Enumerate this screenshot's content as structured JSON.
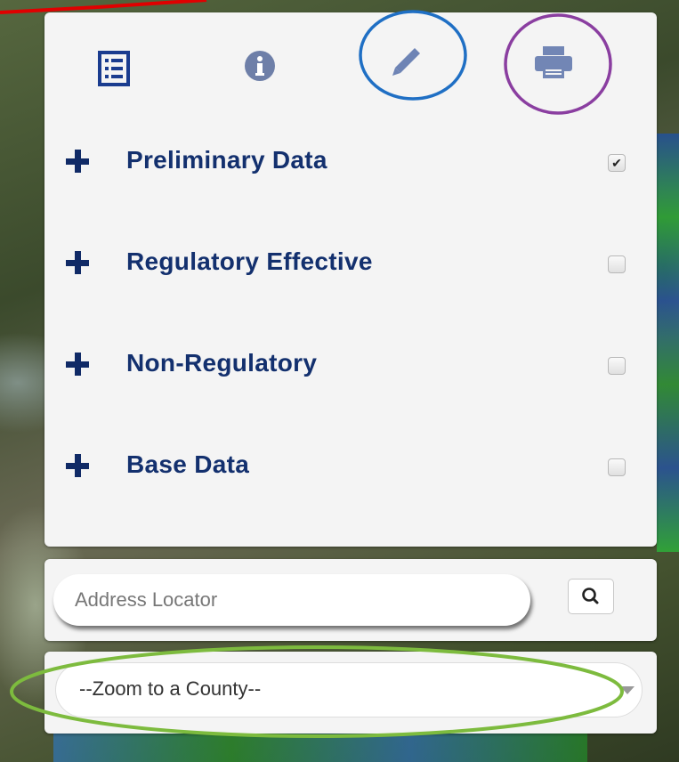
{
  "toolbar": {
    "tabs": [
      {
        "name": "legend-list",
        "icon": "list-icon",
        "color": "#1a3c8f"
      },
      {
        "name": "info",
        "icon": "info-icon",
        "color": "#6e7fa8"
      },
      {
        "name": "edit",
        "icon": "pencil-icon",
        "color": "#6e84b5"
      },
      {
        "name": "print",
        "icon": "printer-icon",
        "color": "#7286b5"
      }
    ]
  },
  "layers": [
    {
      "label": "Preliminary Data",
      "checked": true
    },
    {
      "label": "Regulatory Effective",
      "checked": false
    },
    {
      "label": "Non-Regulatory",
      "checked": false
    },
    {
      "label": "Base Data",
      "checked": false
    }
  ],
  "search": {
    "placeholder": "Address Locator",
    "button_icon": "search-icon"
  },
  "county": {
    "selected": "--Zoom to a County--"
  },
  "annotations": {
    "colors": {
      "red_line": "#e00000",
      "blue_circle": "#1f6fc4",
      "purple_circle": "#8a3ea0",
      "green_ellipse": "#7dbb3e"
    }
  },
  "theme": {
    "label_color": "#13306e",
    "panel_bg": "#f4f4f4"
  }
}
